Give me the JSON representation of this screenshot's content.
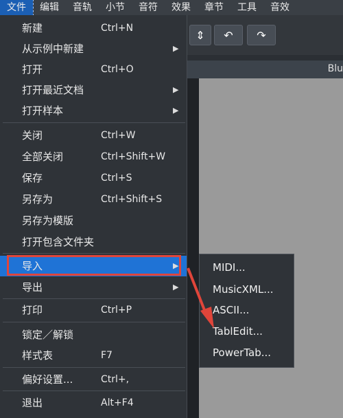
{
  "menubar": {
    "items": [
      {
        "label": "文件"
      },
      {
        "label": "编辑"
      },
      {
        "label": "音轨"
      },
      {
        "label": "小节"
      },
      {
        "label": "音符"
      },
      {
        "label": "效果"
      },
      {
        "label": "章节"
      },
      {
        "label": "工具"
      },
      {
        "label": "音效"
      }
    ]
  },
  "toolbar": {
    "undo_icon": "undo-icon",
    "redo_icon": "redo-icon",
    "stepper_icon": "chevron-updown-icon"
  },
  "header": {
    "partial_text": "Blu"
  },
  "file_menu": {
    "new": {
      "label": "新建",
      "shortcut": "Ctrl+N"
    },
    "new_from_template": {
      "label": "从示例中新建"
    },
    "open": {
      "label": "打开",
      "shortcut": "Ctrl+O"
    },
    "open_recent": {
      "label": "打开最近文档"
    },
    "open_sample": {
      "label": "打开样本"
    },
    "close": {
      "label": "关闭",
      "shortcut": "Ctrl+W"
    },
    "close_all": {
      "label": "全部关闭",
      "shortcut": "Ctrl+Shift+W"
    },
    "save": {
      "label": "保存",
      "shortcut": "Ctrl+S"
    },
    "save_as": {
      "label": "另存为",
      "shortcut": "Ctrl+Shift+S"
    },
    "save_as_template": {
      "label": "另存为模版"
    },
    "open_containing_folder": {
      "label": "打开包含文件夹"
    },
    "import": {
      "label": "导入"
    },
    "export": {
      "label": "导出"
    },
    "print": {
      "label": "打印",
      "shortcut": "Ctrl+P"
    },
    "lock_unlock": {
      "label": "锁定／解锁"
    },
    "stylesheet": {
      "label": "样式表",
      "shortcut": "F7"
    },
    "preferences": {
      "label": "偏好设置...",
      "shortcut": "Ctrl+,"
    },
    "exit": {
      "label": "退出",
      "shortcut": "Alt+F4"
    }
  },
  "import_submenu": {
    "items": [
      {
        "label": "MIDI..."
      },
      {
        "label": "MusicXML..."
      },
      {
        "label": "ASCII..."
      },
      {
        "label": "TablEdit..."
      },
      {
        "label": "PowerTab..."
      }
    ]
  },
  "colors": {
    "highlight": "#1f73d6",
    "annotation_red": "#e0453a",
    "menu_bg": "#2f3338"
  }
}
